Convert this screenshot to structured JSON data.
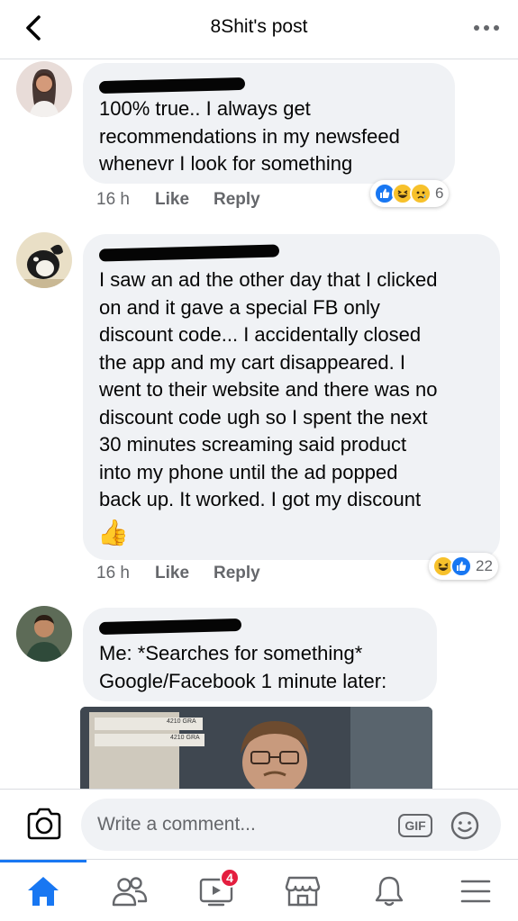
{
  "header": {
    "title": "8Shit's post",
    "back_icon": "chevron-left-icon",
    "more_icon": "ellipsis-icon"
  },
  "comments": [
    {
      "text": "100% true.. I always get\nrecommendations in my newsfeed\nwhenevr  I look for something",
      "time": "16 h",
      "like_label": "Like",
      "reply_label": "Reply",
      "reactions": [
        "like",
        "haha",
        "sad"
      ],
      "reaction_count": "6"
    },
    {
      "text": "I saw an ad the other day that I clicked\non and it gave a special FB only\ndiscount code... I accidentally closed\nthe app and my cart disappeared. I\nwent to their website and there was no\ndiscount code ugh so I spent the next\n30 minutes screaming said product\ninto my phone until the ad popped\nback up. It worked. I got my discount",
      "emoji": "👍",
      "time": "16 h",
      "like_label": "Like",
      "reply_label": "Reply",
      "reactions": [
        "haha",
        "like"
      ],
      "reaction_count": "22"
    },
    {
      "text": "Me: *Searches for something*\nGoogle/Facebook 1 minute later:",
      "image_label_1": "4210 GRA",
      "image_label_2": "4210 GRA"
    }
  ],
  "composer": {
    "placeholder": "Write a comment...",
    "gif_label": "GIF",
    "camera_icon": "camera-icon",
    "emoji_icon": "smiley-icon"
  },
  "navbar": {
    "items": [
      "home-icon",
      "friends-icon",
      "watch-icon",
      "marketplace-icon",
      "notifications-icon",
      "menu-icon"
    ],
    "watch_badge": "4"
  },
  "colors": {
    "accent": "#1877f2",
    "bubble": "#f0f2f5",
    "meta_text": "#65676b",
    "badge": "#e41e3f"
  }
}
